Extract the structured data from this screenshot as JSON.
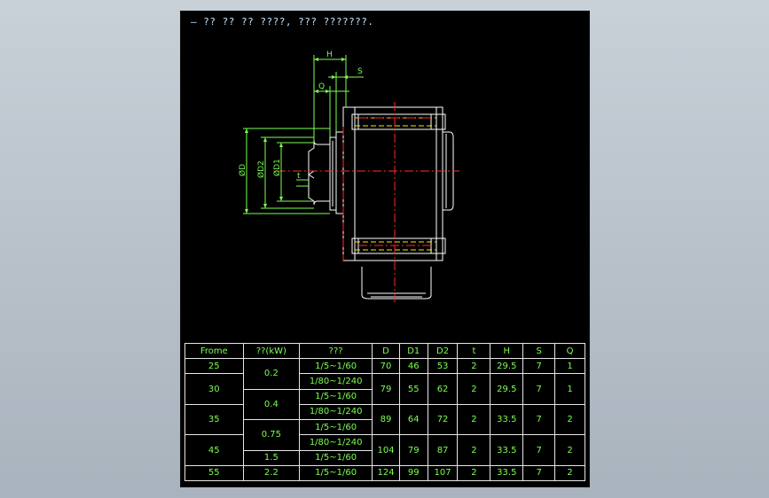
{
  "drawing": {
    "title": "— ?? ?? ?? ????, ??? ???????.",
    "dims": {
      "H": "H",
      "S": "S",
      "Q": "Q",
      "D": "ØD",
      "D2": "ØD2",
      "D1": "ØD1",
      "t": "t"
    }
  },
  "table": {
    "headers": [
      "Frome",
      "??(kW)",
      "???",
      "D",
      "D1",
      "D2",
      "t",
      "H",
      "S",
      "Q"
    ],
    "rows": [
      {
        "frame": "25",
        "power": "0.2",
        "ratio": "1/5~1/60",
        "d": "70",
        "d1": "46",
        "d2": "53",
        "t": "2",
        "h": "29.5",
        "s": "7",
        "q": "1"
      },
      {
        "frame": "30",
        "ratio_a": "1/80~1/240",
        "ratio_b": "1/5~1/60",
        "d": "79",
        "d1": "55",
        "d2": "62",
        "t": "2",
        "h": "29.5",
        "s": "7",
        "q": "1"
      },
      {
        "frame": "35",
        "power": "0.4",
        "ratio_a": "1/80~1/240",
        "ratio_b": "1/5~1/60",
        "d": "89",
        "d1": "64",
        "d2": "72",
        "t": "2",
        "h": "33.5",
        "s": "7",
        "q": "2"
      },
      {
        "frame": "45",
        "power_a": "0.75",
        "power_b": "1.5",
        "ratio_a": "1/80~1/240",
        "ratio_b": "1/5~1/60",
        "d": "104",
        "d1": "79",
        "d2": "87",
        "t": "2",
        "h": "33.5",
        "s": "7",
        "q": "2"
      },
      {
        "frame": "55",
        "power": "2.2",
        "ratio": "1/5~1/60",
        "d": "124",
        "d1": "99",
        "d2": "107",
        "t": "2",
        "h": "33.5",
        "s": "7",
        "q": "2"
      }
    ]
  },
  "colors": {
    "canvas": "#000000",
    "dimension": "#7cff52",
    "outline": "#ffffff",
    "center_line": "#ff2a2a",
    "hidden_line": "#ffe600"
  }
}
